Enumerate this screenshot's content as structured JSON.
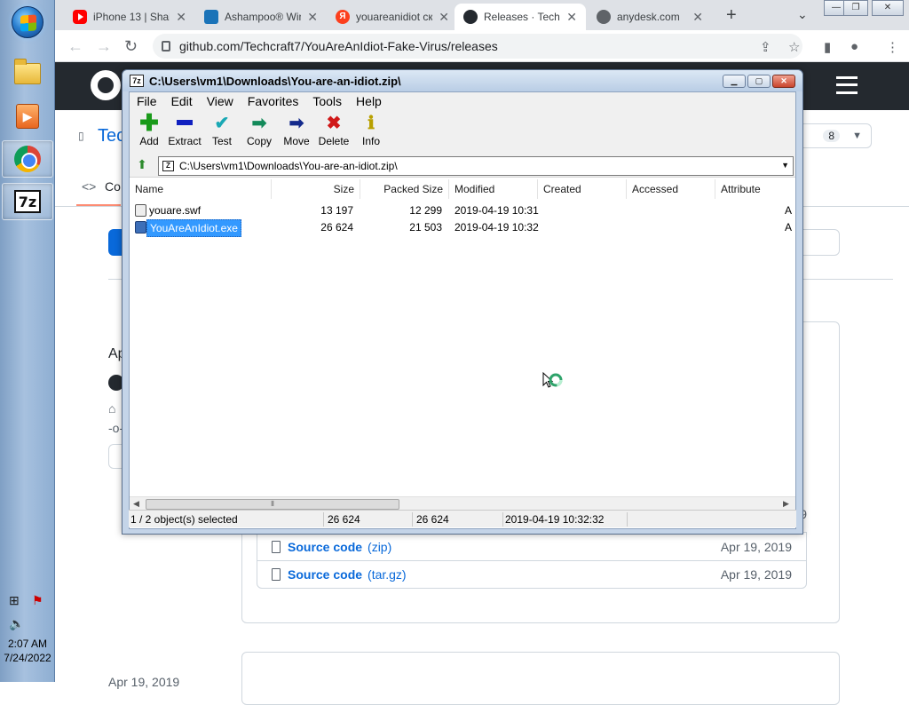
{
  "taskbar": {
    "apps": [
      {
        "name": "start"
      },
      {
        "name": "windows-explorer"
      },
      {
        "name": "media-player"
      },
      {
        "name": "chrome"
      },
      {
        "name": "7zip",
        "label": "7z"
      }
    ],
    "clock_time": "2:07 AM",
    "clock_date": "7/24/2022"
  },
  "browser": {
    "tabs": [
      {
        "title": "iPhone 13 | Shal",
        "favicon": "youtube"
      },
      {
        "title": "Ashampoo® Win",
        "favicon": "ashampoo"
      },
      {
        "title": "youareanidiot ск",
        "favicon": "yandex"
      },
      {
        "title": "Releases · Techc",
        "favicon": "github"
      },
      {
        "title": "anydesk.com",
        "favicon": "globe"
      }
    ],
    "url": "github.com/Techcraft7/YouAreAnIdiot-Fake-Virus/releases"
  },
  "github": {
    "repo_partial": "Tec",
    "tab_partial": "Co",
    "star_count": "8",
    "release_partial": "Ap",
    "asset_date_partial": "19",
    "assets": [
      {
        "name": "Source code",
        "ext": "(zip)",
        "date": "Apr 19, 2019"
      },
      {
        "name": "Source code",
        "ext": "(tar.gz)",
        "date": "Apr 19, 2019"
      }
    ],
    "bottom_date_partial": "Apr 19, 2019"
  },
  "sevenzip": {
    "title": "C:\\Users\\vm1\\Downloads\\You-are-an-idiot.zip\\",
    "menu": [
      "File",
      "Edit",
      "View",
      "Favorites",
      "Tools",
      "Help"
    ],
    "tools": [
      {
        "label": "Add",
        "icon": "plus-icon",
        "color": "#1a9a1a"
      },
      {
        "label": "Extract",
        "icon": "minus-icon",
        "color": "#1020c0"
      },
      {
        "label": "Test",
        "icon": "check-icon",
        "color": "#19a8b4"
      },
      {
        "label": "Copy",
        "icon": "arrow-right-icon",
        "color": "#138a5a"
      },
      {
        "label": "Move",
        "icon": "arrow-right-icon",
        "color": "#142a8c"
      },
      {
        "label": "Delete",
        "icon": "x-icon",
        "color": "#d01818"
      },
      {
        "label": "Info",
        "icon": "info-icon",
        "color": "#b8a000"
      }
    ],
    "address": "C:\\Users\\vm1\\Downloads\\You-are-an-idiot.zip\\",
    "columns": [
      "Name",
      "Size",
      "Packed Size",
      "Modified",
      "Created",
      "Accessed",
      "Attribute"
    ],
    "files": [
      {
        "name": "youare.swf",
        "size": "13 197",
        "packed": "12 299",
        "modified": "2019-04-19 10:31",
        "attr": "A",
        "selected": false
      },
      {
        "name": "YouAreAnIdiot.exe",
        "size": "26 624",
        "packed": "21 503",
        "modified": "2019-04-19 10:32",
        "attr": "A",
        "selected": true
      }
    ],
    "status": {
      "selected": "1 / 2 object(s) selected",
      "size": "26 624",
      "packed": "26 624",
      "modified": "2019-04-19 10:32:32"
    }
  }
}
